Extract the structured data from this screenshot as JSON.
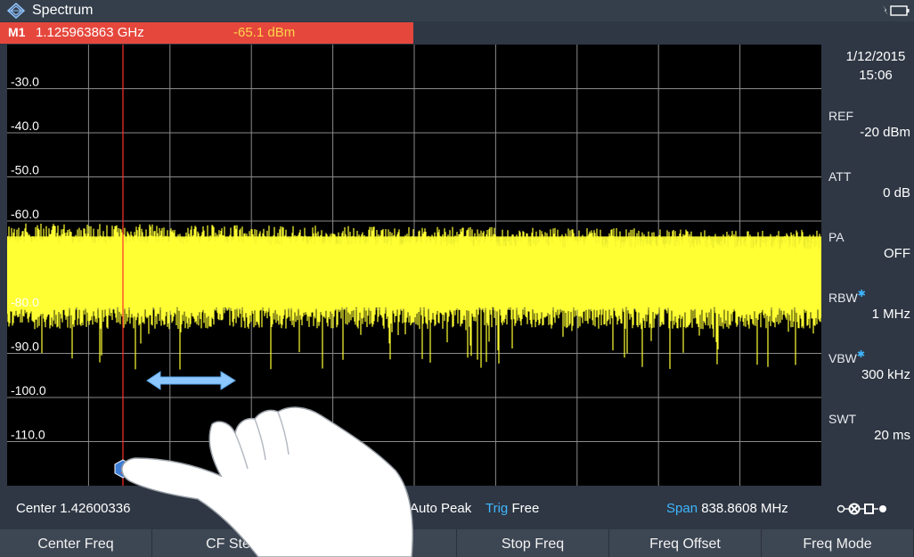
{
  "app": {
    "title": "Spectrum"
  },
  "marker": {
    "label": "M1",
    "frequency": "1.125963863 GHz",
    "level": "-65.1 dBm"
  },
  "datetime": {
    "date": "1/12/2015",
    "time": "15:06"
  },
  "plot": {
    "y_tick_labels": [
      {
        "value": -30,
        "label": "-30.0"
      },
      {
        "value": -40,
        "label": "-40.0"
      },
      {
        "value": -50,
        "label": "-50.0"
      },
      {
        "value": -60,
        "label": "-60.0"
      },
      {
        "value": -80,
        "label": "-80.0"
      },
      {
        "value": -90,
        "label": "-90.0"
      },
      {
        "value": -100,
        "label": "-100.0"
      },
      {
        "value": -110,
        "label": "-110.0"
      }
    ],
    "marker_badge": "1",
    "trace_color": "#ffff33",
    "marker_color": "#ff3030"
  },
  "params": [
    {
      "label": "REF",
      "value": "-20 dBm",
      "starred": false
    },
    {
      "label": "ATT",
      "value": "0 dB",
      "starred": false
    },
    {
      "label": "PA",
      "value": "OFF",
      "starred": false
    },
    {
      "label": "RBW",
      "value": "1 MHz",
      "starred": true
    },
    {
      "label": "VBW",
      "value": "300 kHz",
      "starred": true
    },
    {
      "label": "SWT",
      "value": "20 ms",
      "starred": false
    }
  ],
  "status": {
    "center_label": "Center",
    "center_value": "1.42600336",
    "detector": "Auto Peak",
    "trig_label": "Trig",
    "trig_value": "Free",
    "span_label": "Span",
    "span_value": "838.8608 MHz"
  },
  "softkeys": [
    "Center Freq",
    "CF Ste",
    "eq",
    "Stop Freq",
    "Freq Offset",
    "Freq Mode"
  ],
  "icons": {
    "logo": "rohde-schwarz-logo",
    "battery": "battery-icon",
    "connection": "connection-status-icon",
    "hand": "touch-hand-icon",
    "drag": "drag-arrow-icon"
  },
  "colors": {
    "accent": "#3fb6ff",
    "marker_bar": "#e5473c",
    "trace": "#ffff33"
  }
}
